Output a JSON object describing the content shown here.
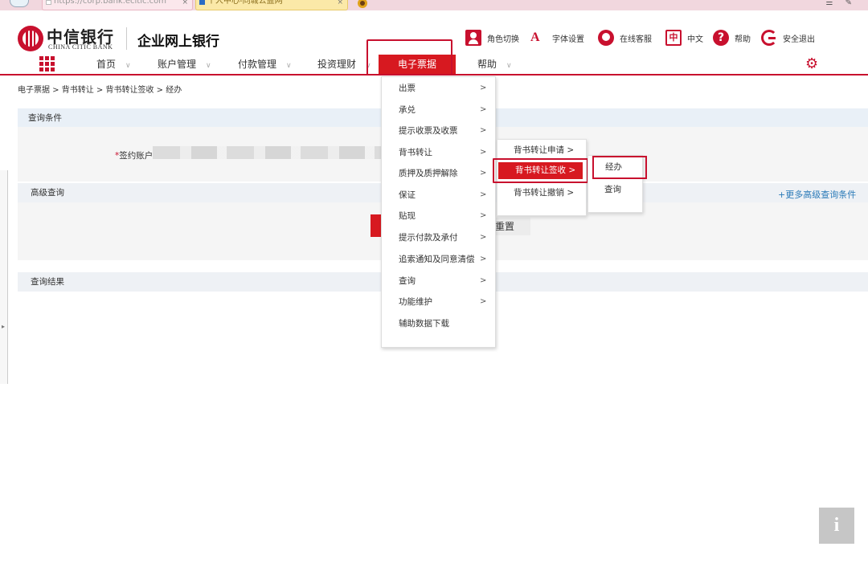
{
  "browser": {
    "tabs": [
      {
        "label": "https://corp.bank.ecitic.com",
        "close": "×"
      },
      {
        "label": "个人中心-同城公益网",
        "close": "×"
      }
    ]
  },
  "header": {
    "brand_cn": "中信银行",
    "brand_en": "CHINA CITIC BANK",
    "app_title": "企业网上银行",
    "tools": [
      {
        "icon": "role-switch-icon",
        "label": "角色切换"
      },
      {
        "icon": "font-settings-icon",
        "label": "字体设置"
      },
      {
        "icon": "customer-service-icon",
        "label": "在线客服"
      },
      {
        "icon": "language-icon",
        "label": "中文"
      },
      {
        "icon": "help-icon",
        "label": "帮助"
      },
      {
        "icon": "logout-icon",
        "label": "安全退出"
      }
    ],
    "font_glyph": "A",
    "lang_glyph": "中",
    "help_glyph": "?"
  },
  "nav": {
    "items": [
      {
        "label": "首页"
      },
      {
        "label": "账户管理"
      },
      {
        "label": "付款管理"
      },
      {
        "label": "投资理财"
      },
      {
        "label": "电子票据"
      },
      {
        "label": "帮助"
      }
    ],
    "chevron": "∨",
    "gear": "⚙"
  },
  "breadcrumb": "电子票据 > 背书转让 > 背书转让签收 > 经办",
  "query": {
    "section_title": "查询条件",
    "account_label_required": "*",
    "account_label": "签约账户",
    "advanced_title": "高级查询",
    "more_conditions": "+更多高级查询条件",
    "reset_label": "重置",
    "results_title": "查询结果"
  },
  "menu": {
    "items": [
      {
        "label": "出票",
        "arrow": ">"
      },
      {
        "label": "承兑",
        "arrow": ">"
      },
      {
        "label": "提示收票及收票",
        "arrow": ">"
      },
      {
        "label": "背书转让",
        "arrow": ">"
      },
      {
        "label": "质押及质押解除",
        "arrow": ">"
      },
      {
        "label": "保证",
        "arrow": ">"
      },
      {
        "label": "贴现",
        "arrow": ">"
      },
      {
        "label": "提示付款及承付",
        "arrow": ">"
      },
      {
        "label": "追索通知及同意清偿",
        "arrow": ">"
      },
      {
        "label": "查询",
        "arrow": ">"
      },
      {
        "label": "功能维护",
        "arrow": ">"
      },
      {
        "label": "辅助数据下载",
        "arrow": ""
      }
    ],
    "submenu": [
      {
        "label": "背书转让申请 >"
      },
      {
        "label": "背书转让签收 >"
      },
      {
        "label": "背书转让撤销 >"
      }
    ],
    "submenu3": [
      {
        "label": "经办"
      },
      {
        "label": "查询"
      }
    ]
  },
  "info_button": "i",
  "colors": {
    "brand_red": "#c8102e",
    "menu_active": "#d71920",
    "link_blue": "#2a7ab8"
  }
}
